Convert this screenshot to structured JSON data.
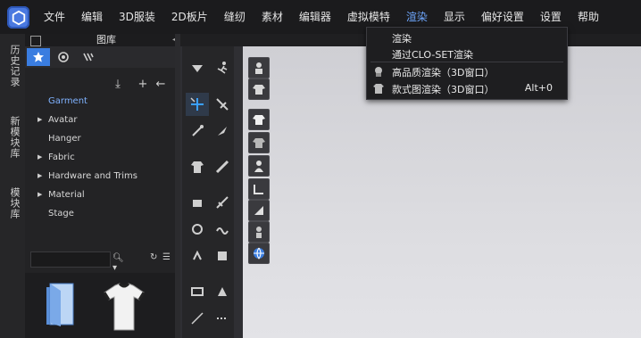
{
  "menubar": {
    "items": [
      "文件",
      "编辑",
      "3D服装",
      "2D板片",
      "缝纫",
      "素材",
      "编辑器",
      "虚拟模特",
      "渲染",
      "显示",
      "偏好设置",
      "设置",
      "帮助"
    ],
    "active_index": 8,
    "active_color": "#6fa8ff"
  },
  "dropdown": {
    "items": [
      {
        "label": "渲染",
        "shortcut": ""
      },
      {
        "label": "通过CLO-SET渲染",
        "shortcut": ""
      },
      {
        "label": "高品质渲染（3D窗口）",
        "shortcut": ""
      },
      {
        "label": "款式图渲染（3D窗口）",
        "shortcut": "Alt+0"
      }
    ]
  },
  "side_tabs": [
    "历史记录",
    "新模块库",
    "模块库"
  ],
  "library": {
    "title": "图库",
    "tree": [
      {
        "label": "Garment",
        "expandable": false,
        "selected": true
      },
      {
        "label": "Avatar",
        "expandable": true,
        "selected": false
      },
      {
        "label": "Hanger",
        "expandable": false,
        "selected": false
      },
      {
        "label": "Fabric",
        "expandable": true,
        "selected": false
      },
      {
        "label": "Hardware and Trims",
        "expandable": true,
        "selected": false
      },
      {
        "label": "Material",
        "expandable": true,
        "selected": false
      },
      {
        "label": "Stage",
        "expandable": false,
        "selected": false
      }
    ]
  },
  "colors": {
    "accent": "#3a7de0",
    "selected_text": "#7fb2ff"
  }
}
